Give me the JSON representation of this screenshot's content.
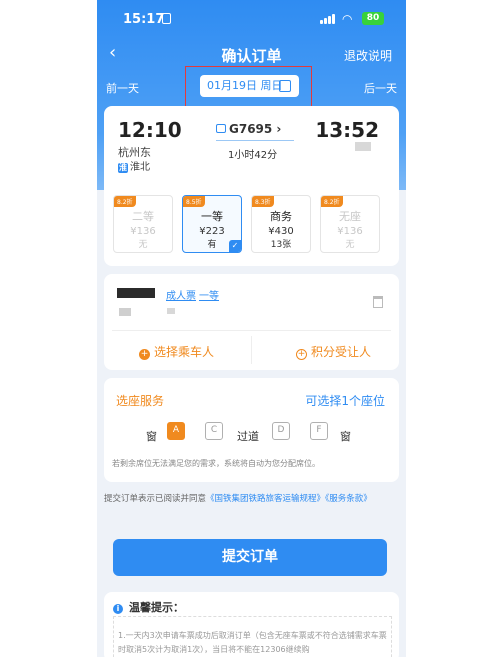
{
  "status": {
    "time": "15:17",
    "battery": "80"
  },
  "nav": {
    "back": "‹",
    "title": "确认订单",
    "refund_label": "退改说明"
  },
  "day_nav": {
    "prev": "前一天",
    "date": "01月19日 周日",
    "next": "后一天"
  },
  "train": {
    "depart_time": "12:10",
    "depart_station": "杭州东",
    "depart_tag": "淮北",
    "number": "G7695",
    "duration": "1小时42分",
    "arrive_time": "13:52"
  },
  "seats": [
    {
      "points": "8.2折",
      "name": "二等",
      "price": "¥136",
      "avail": "无"
    },
    {
      "points": "8.5折",
      "name": "一等",
      "price": "¥223",
      "avail": "有"
    },
    {
      "points": "8.3折",
      "name": "商务",
      "price": "¥430",
      "avail": "13张"
    },
    {
      "points": "8.2折",
      "name": "无座",
      "price": "¥136",
      "avail": "无"
    }
  ],
  "passenger": {
    "ticket_type": "成人票",
    "seat_class": "一等",
    "add_passenger": "选择乘车人",
    "add_member": "积分受让人"
  },
  "seat_select": {
    "title": "选座服务",
    "link": "可选择1个座位",
    "window_left": "窗",
    "aisle": "过道",
    "window_right": "窗",
    "seats": [
      "A",
      "C",
      "D",
      "F"
    ],
    "note": "若剩余席位无法满足您的需求，系统将自动为您分配席位。"
  },
  "agreement": {
    "prefix": "提交订单表示已阅读并同意",
    "link1": "《国铁集团铁路旅客运输规程》",
    "link2": "《服务条款》"
  },
  "submit_label": "提交订单",
  "tips": {
    "title": "温馨提示：",
    "text": "1.一天内3次申请车票成功后取消订单（包含无座车票或不符合选铺需求车票时取消5次计为取消1次），当日将不能在12306继续购"
  },
  "colors": {
    "brand": "#2f8cf2",
    "accent": "#f08a1f"
  }
}
